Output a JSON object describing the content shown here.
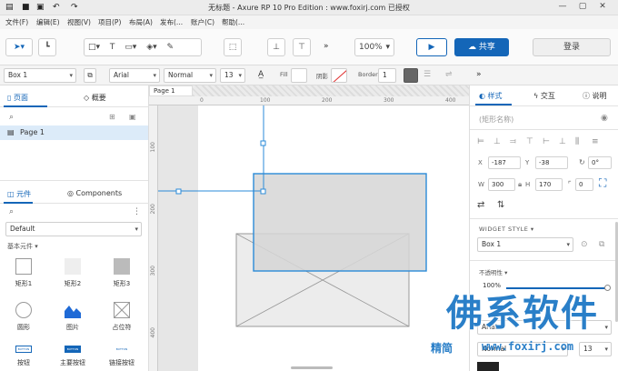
{
  "window": {
    "title": "无标题 - Axure RP 10 Pro Edition : www.foxirj.com 已授权"
  },
  "menu": [
    "文件(F)",
    "编辑(E)",
    "视图(V)",
    "项目(P)",
    "布局(A)",
    "发布(...",
    "账户(C)",
    "帮助(..."
  ],
  "toolbar": {
    "zoom": "100%",
    "share": "共享",
    "login": "登录",
    "more": "»"
  },
  "format": {
    "style_name": "Box 1",
    "font": "Arial",
    "weight": "Normal",
    "size": "13",
    "fill_label": "Fill",
    "stroke_label": "阴影",
    "border_label": "Border",
    "border_value": "1"
  },
  "left": {
    "tab_pages": "页面",
    "tab_outline": "概要",
    "page1": "Page 1",
    "tab_widgets": "元件",
    "tab_components": "Components",
    "library": "Default",
    "category": "基本元件 ▾",
    "widgets": [
      "矩形1",
      "矩形2",
      "矩形3",
      "圆形",
      "图片",
      "占位符",
      "按钮",
      "主要按钮",
      "链接按钮"
    ],
    "btn_mini": "BUTTON"
  },
  "canvas": {
    "page_tab": "Page 1",
    "ruler_top": [
      "0",
      "100",
      "200",
      "300",
      "400"
    ],
    "ruler_left": [
      "100",
      "200",
      "300",
      "400"
    ]
  },
  "right": {
    "tab_style": "样式",
    "tab_interact": "交互",
    "tab_notes": "说明",
    "shape_name_placeholder": "(矩形名称)",
    "x_label": "X",
    "x": "-187",
    "y_label": "Y",
    "y": "-38",
    "rot": "0°",
    "w_label": "W",
    "w": "300",
    "h_label": "H",
    "h": "170",
    "radius": "0",
    "widget_style_title": "WIDGET STYLE ▾",
    "widget_style": "Box 1",
    "opacity_label": "不透明性 ▾",
    "opacity": "100%",
    "font": "Arial",
    "weight": "Normal",
    "size": "13"
  },
  "watermark": {
    "main": "佛系软件",
    "sub1": "精简",
    "sub2": "www.foxirj.com"
  },
  "colors": {
    "accent": "#1466b8",
    "selection": "#2b8bd8",
    "box_fill": "#d6d6d6",
    "watermark": "#2a7fc8"
  }
}
